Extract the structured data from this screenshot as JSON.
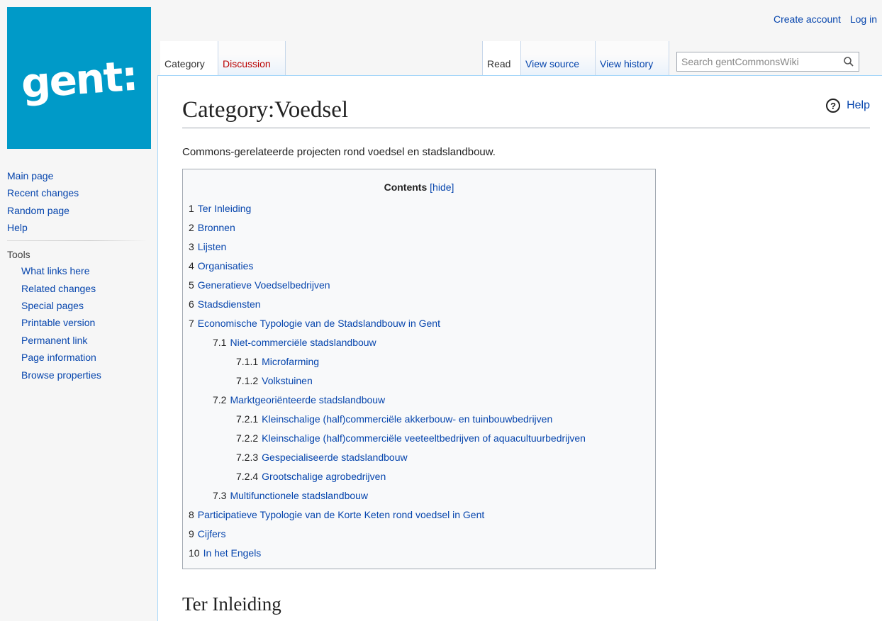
{
  "personal": {
    "create_account": "Create account",
    "log_in": "Log in"
  },
  "logo": {
    "text": "gent:",
    "bg_color": "#009ac8"
  },
  "tabs": {
    "category": "Category",
    "discussion": "Discussion",
    "read": "Read",
    "view_source": "View source",
    "view_history": "View history"
  },
  "search": {
    "placeholder": "Search gentCommonsWiki",
    "icon": "search-icon"
  },
  "sidebar": {
    "nav": [
      "Main page",
      "Recent changes",
      "Random page",
      "Help"
    ],
    "tools_heading": "Tools",
    "tools": [
      "What links here",
      "Related changes",
      "Special pages",
      "Printable version",
      "Permanent link",
      "Page information",
      "Browse properties"
    ]
  },
  "page": {
    "help": "Help",
    "title": "Category:Voedsel",
    "intro": "Commons-gerelateerde projecten rond voedsel en stadslandbouw.",
    "section_heading": "Ter Inleiding"
  },
  "toc": {
    "heading": "Contents",
    "hide_label": "[hide]",
    "items": [
      {
        "num": "1",
        "text": "Ter Inleiding",
        "level": 1
      },
      {
        "num": "2",
        "text": "Bronnen",
        "level": 1
      },
      {
        "num": "3",
        "text": "Lijsten",
        "level": 1
      },
      {
        "num": "4",
        "text": "Organisaties",
        "level": 1
      },
      {
        "num": "5",
        "text": "Generatieve Voedselbedrijven",
        "level": 1
      },
      {
        "num": "6",
        "text": "Stadsdiensten",
        "level": 1
      },
      {
        "num": "7",
        "text": "Economische Typologie van de Stadslandbouw in Gent",
        "level": 1
      },
      {
        "num": "7.1",
        "text": "Niet-commerciële stadslandbouw",
        "level": 2
      },
      {
        "num": "7.1.1",
        "text": "Microfarming",
        "level": 3
      },
      {
        "num": "7.1.2",
        "text": "Volkstuinen",
        "level": 3
      },
      {
        "num": "7.2",
        "text": "Marktgeoriënteerde stadslandbouw",
        "level": 2
      },
      {
        "num": "7.2.1",
        "text": "Kleinschalige (half)commerciële akkerbouw- en tuinbouwbedrijven",
        "level": 3
      },
      {
        "num": "7.2.2",
        "text": "Kleinschalige (half)commerciële veeteeltbedrijven of aquacultuurbedrijven",
        "level": 3
      },
      {
        "num": "7.2.3",
        "text": "Gespecialiseerde stadslandbouw",
        "level": 3
      },
      {
        "num": "7.2.4",
        "text": "Grootschalige agrobedrijven",
        "level": 3
      },
      {
        "num": "7.3",
        "text": "Multifunctionele stadslandbouw",
        "level": 2
      },
      {
        "num": "8",
        "text": "Participatieve Typologie van de Korte Keten rond voedsel in Gent",
        "level": 1
      },
      {
        "num": "9",
        "text": "Cijfers",
        "level": 1
      },
      {
        "num": "10",
        "text": "In het Engels",
        "level": 1
      }
    ]
  }
}
